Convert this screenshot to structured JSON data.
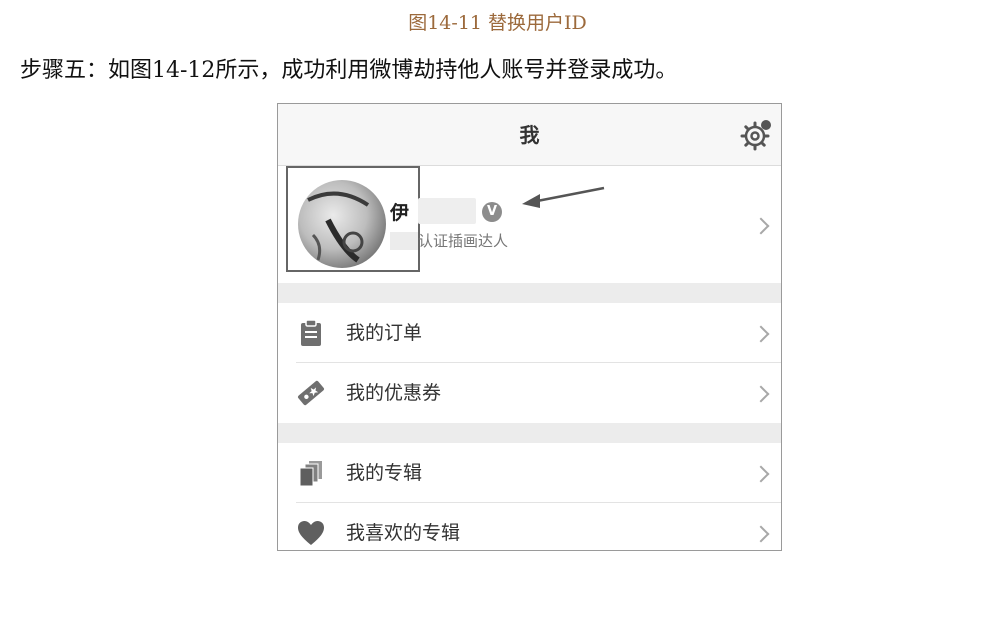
{
  "caption": "图14-11 替换用户ID",
  "step_text": "步骤五：如图14-12所示，成功利用微博劫持他人账号并登录成功。",
  "app": {
    "nav_title": "我",
    "profile": {
      "name": "伊",
      "badge": "V",
      "description": "认证插画达人"
    },
    "menu_groups": [
      [
        {
          "label": "我的订单",
          "icon": "clipboard-icon"
        },
        {
          "label": "我的优惠券",
          "icon": "coupon-icon"
        }
      ],
      [
        {
          "label": "我的专辑",
          "icon": "album-stack-icon"
        },
        {
          "label": "我喜欢的专辑",
          "icon": "heart-icon"
        }
      ]
    ]
  },
  "colors": {
    "caption": "#9c6a3c",
    "icon": "#6f6f6f",
    "divider_band": "#ececec"
  }
}
